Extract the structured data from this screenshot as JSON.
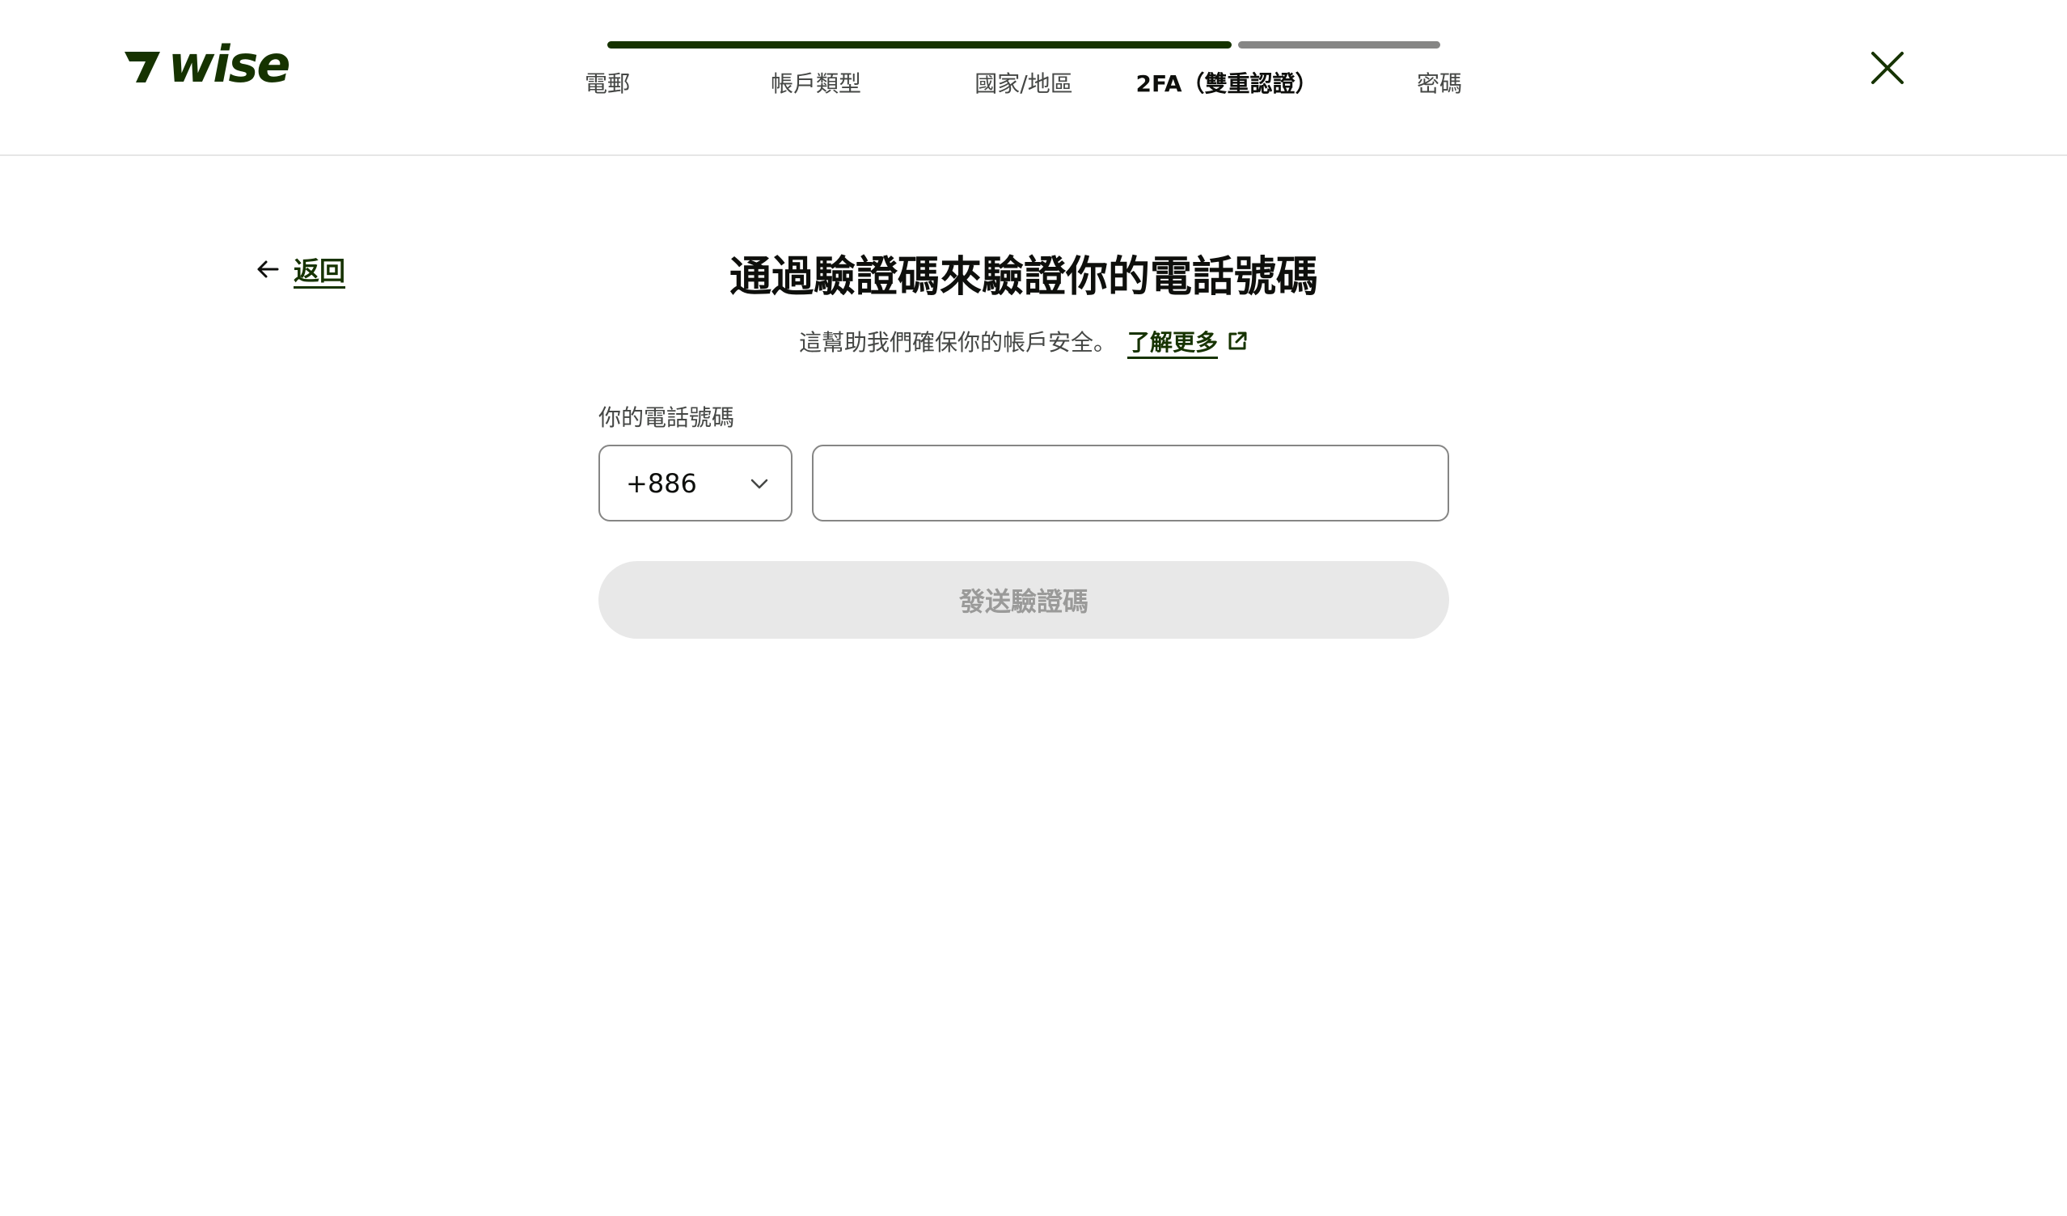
{
  "brand": {
    "name": "wise",
    "color": "#163300"
  },
  "steps": [
    {
      "label": "電郵",
      "state": "done"
    },
    {
      "label": "帳戶類型",
      "state": "done"
    },
    {
      "label": "國家/地區",
      "state": "done"
    },
    {
      "label": "2FA（雙重認證）",
      "state": "active"
    },
    {
      "label": "密碼",
      "state": "pending"
    }
  ],
  "progress": {
    "fraction": 0.75
  },
  "back": {
    "label": "返回"
  },
  "main": {
    "title": "通過驗證碼來驗證你的電話號碼",
    "subtitle": "這幫助我們確保你的帳戶安全。",
    "learn_more": "了解更多"
  },
  "form": {
    "phone_label": "你的電話號碼",
    "country_code": "+886",
    "phone_value": "",
    "send_label": "發送驗證碼",
    "send_disabled": true
  },
  "icons": {
    "close": "close-icon",
    "back": "arrow-left-icon",
    "external": "external-link-icon",
    "chevron": "chevron-down-icon"
  }
}
